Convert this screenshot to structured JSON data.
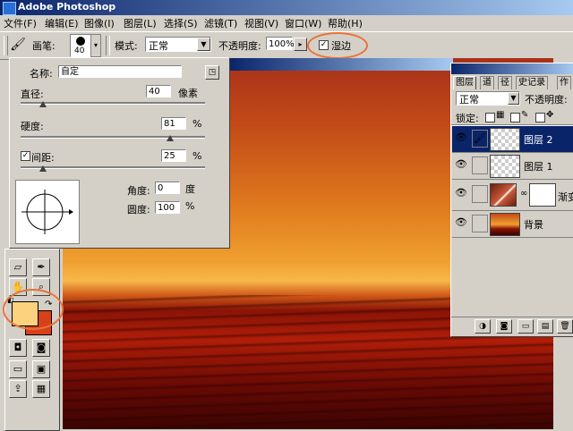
{
  "app": {
    "title": "Adobe Photoshop"
  },
  "menu": [
    "文件(F)",
    "编辑(E)",
    "图像(I)",
    "图层(L)",
    "选择(S)",
    "滤镜(T)",
    "视图(V)",
    "窗口(W)",
    "帮助(H)"
  ],
  "options": {
    "brush_label": "画笔:",
    "brush_size": "40",
    "mode_label": "模式:",
    "mode_value": "正常",
    "opacity_label": "不透明度:",
    "opacity_value": "100%",
    "wet_edges_label": "湿边",
    "wet_edges_checked": "✓"
  },
  "brush_panel": {
    "name_label": "名称:",
    "name_value": "自定",
    "diameter_label": "直径:",
    "diameter_value": "40",
    "diameter_unit": "像素",
    "diameter_fraction": 0.12,
    "hardness_label": "硬度:",
    "hardness_value": "81",
    "hardness_unit": "%",
    "hardness_fraction": 0.81,
    "spacing_label": "间距:",
    "spacing_value": "25",
    "spacing_unit": "%",
    "spacing_fraction": 0.12,
    "spacing_checked": "✓",
    "angle_label": "角度:",
    "angle_value": "0",
    "angle_unit": "度",
    "roundness_label": "圆度:",
    "roundness_value": "100",
    "roundness_unit": "%"
  },
  "layers_panel": {
    "tabs": [
      "图层",
      "道",
      "径",
      "史记录",
      "作"
    ],
    "blend_mode": "正常",
    "opacity_label": "不透明度:",
    "lock_label": "锁定:",
    "layers": [
      {
        "name": "图层 2",
        "selected": true
      },
      {
        "name": "图层 1",
        "selected": false
      },
      {
        "name": "渐变",
        "selected": false
      },
      {
        "name": "背景",
        "selected": false
      }
    ]
  },
  "colors": {
    "foreground": "#fdd27e",
    "background": "#d8401a",
    "highlight_ring": "#e8723a",
    "selected_layer": "#0a246a"
  }
}
